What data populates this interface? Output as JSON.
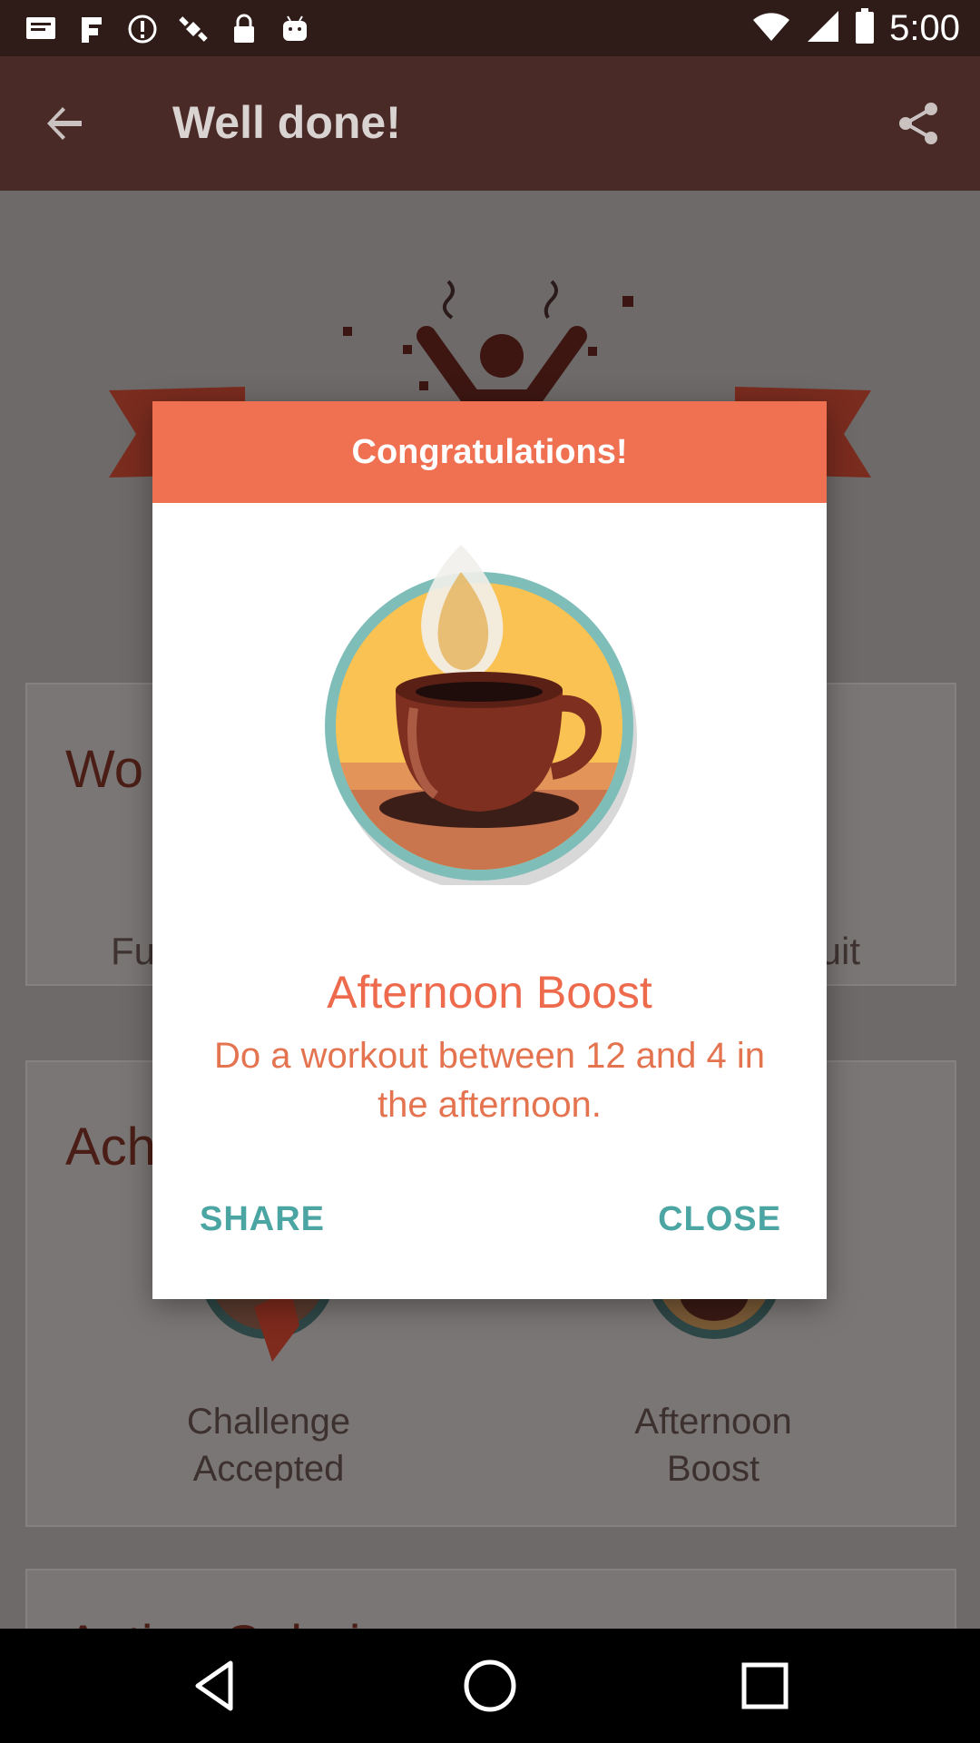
{
  "status_bar": {
    "time": "5:00",
    "icons": [
      "message-icon",
      "fake-gps-icon",
      "warning-icon",
      "satellite-icon",
      "lock-icon",
      "android-icon",
      "wifi-icon",
      "signal-icon",
      "battery-icon"
    ]
  },
  "app_bar": {
    "title": "Well done!",
    "back_icon": "arrow-back-icon",
    "share_icon": "share-icon"
  },
  "background": {
    "card1_heading": "Wo",
    "card1_left_label": "Fu",
    "card1_right_label": "uit",
    "card2_heading": "Ach",
    "badge_left_label": "Challenge\nAccepted",
    "badge_right_label": "Afternoon\nBoost",
    "card3_heading": "Active Calories"
  },
  "dialog": {
    "header": "Congratulations!",
    "image_icon": "coffee-cup-badge-icon",
    "title": "Afternoon Boost",
    "description": "Do a workout between 12 and 4 in the afternoon.",
    "share_label": "SHARE",
    "close_label": "CLOSE"
  },
  "colors": {
    "header_accent": "#f07052",
    "button_teal": "#4aa5a3",
    "title_orange": "#ee6a4c"
  }
}
